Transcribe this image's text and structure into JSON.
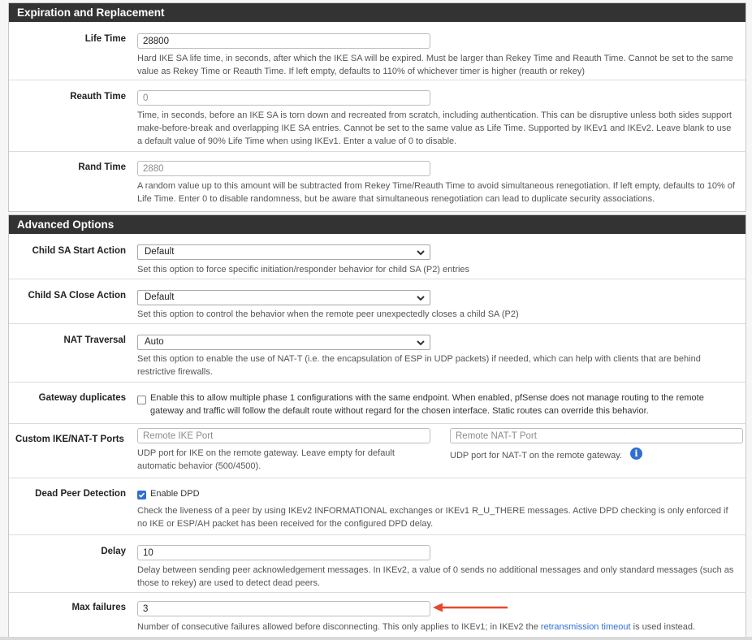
{
  "expiration": {
    "title": "Expiration and Replacement",
    "life_time": {
      "label": "Life Time",
      "value": "28800",
      "help": "Hard IKE SA life time, in seconds, after which the IKE SA will be expired. Must be larger than Rekey Time and Reauth Time. Cannot be set to the same value as Rekey Time or Reauth Time. If left empty, defaults to 110% of whichever timer is higher (reauth or rekey)"
    },
    "reauth_time": {
      "label": "Reauth Time",
      "placeholder": "0",
      "help": "Time, in seconds, before an IKE SA is torn down and recreated from scratch, including authentication. This can be disruptive unless both sides support make-before-break and overlapping IKE SA entries. Cannot be set to the same value as Life Time. Supported by IKEv1 and IKEv2. Leave blank to use a default value of 90% Life Time when using IKEv1. Enter a value of 0 to disable."
    },
    "rand_time": {
      "label": "Rand Time",
      "placeholder": "2880",
      "help": "A random value up to this amount will be subtracted from Rekey Time/Reauth Time to avoid simultaneous renegotiation. If left empty, defaults to 10% of Life Time. Enter 0 to disable randomness, but be aware that simultaneous renegotiation can lead to duplicate security associations."
    }
  },
  "advanced": {
    "title": "Advanced Options",
    "child_start": {
      "label": "Child SA Start Action",
      "selected": "Default",
      "help": "Set this option to force specific initiation/responder behavior for child SA (P2) entries"
    },
    "child_close": {
      "label": "Child SA Close Action",
      "selected": "Default",
      "help": "Set this option to control the behavior when the remote peer unexpectedly closes a child SA (P2)"
    },
    "nat_traversal": {
      "label": "NAT Traversal",
      "selected": "Auto",
      "help": "Set this option to enable the use of NAT-T (i.e. the encapsulation of ESP in UDP packets) if needed, which can help with clients that are behind restrictive firewalls."
    },
    "gateway_dup": {
      "label": "Gateway duplicates",
      "checked": false,
      "text": "Enable this to allow multiple phase 1 configurations with the same endpoint. When enabled, pfSense does not manage routing to the remote gateway and traffic will follow the default route without regard for the chosen interface. Static routes can override this behavior."
    },
    "custom_ports": {
      "label": "Custom IKE/NAT-T Ports",
      "ike_placeholder": "Remote IKE Port",
      "ike_help": "UDP port for IKE on the remote gateway. Leave empty for default automatic behavior (500/4500).",
      "natt_placeholder": "Remote NAT-T Port",
      "natt_help": "UDP port for NAT-T on the remote gateway."
    },
    "dpd": {
      "label": "Dead Peer Detection",
      "checked": true,
      "checkbox_label": "Enable DPD",
      "help": "Check the liveness of a peer by using IKEv2 INFORMATIONAL exchanges or IKEv1 R_U_THERE messages. Active DPD checking is only enforced if no IKE or ESP/AH packet has been received for the configured DPD delay."
    },
    "delay": {
      "label": "Delay",
      "value": "10",
      "help": "Delay between sending peer acknowledgement messages. In IKEv2, a value of 0 sends no additional messages and only standard messages (such as those to rekey) are used to detect dead peers."
    },
    "max_failures": {
      "label": "Max failures",
      "value": "3",
      "help_before": "Number of consecutive failures allowed before disconnecting. This only applies to IKEv1; in IKEv2 the ",
      "help_link": "retransmission timeout",
      "help_after": " is used instead."
    }
  },
  "colors": {
    "header_bg": "#333333",
    "accent": "#2f6fd1",
    "arrow": "#e8472a"
  }
}
